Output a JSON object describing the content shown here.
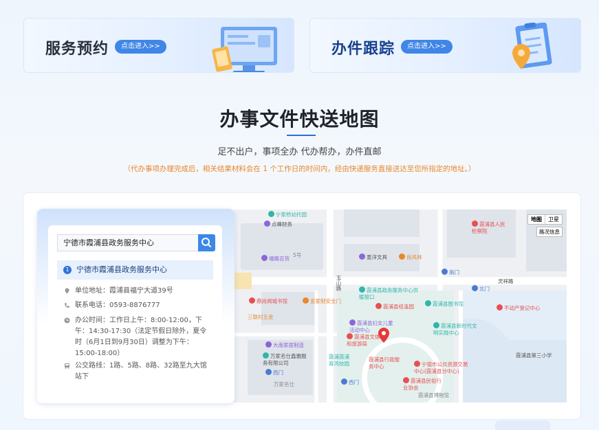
{
  "cards": {
    "appointment": {
      "title": "服务预约",
      "button": "点击进入>>"
    },
    "tracking": {
      "title": "办件跟踪",
      "button": "点击进入>>"
    }
  },
  "section": {
    "title": "办事文件快送地图",
    "subtitle": "足不出户，事项全办 代办帮办，办件直邮",
    "notice": "（代办事项办理完成后，相关结果材料会在 1 个工作日的时间内，经由快递服务直接送达至您所指定的地址。）"
  },
  "search": {
    "value": "宁德市霞浦县政务服务中心"
  },
  "result": {
    "index": "1",
    "name": "宁德市霞浦县政务服务中心",
    "address": "单位地址：霞浦县福宁大道39号",
    "phone": "联系电话：0593-8876777",
    "hours": "办公时间：工作日上午：8:00-12:00，下午：14:30-17:30（法定节假日除外，夏令时（6月1日到9月30日）调整为下午：15:00-18:00）",
    "bus": "公交路线：1路、5路、8路、32路至九大馆站下"
  },
  "map": {
    "controls": {
      "map": "地图",
      "satellite": "卫星",
      "traffic": "路况信息"
    },
    "roads": {
      "lingxiang": "灵祥路",
      "yushan": "玉山路"
    },
    "pois": [
      {
        "id": "p1",
        "label": "宁家桥幼托园",
        "color": "#2fb6a8"
      },
      {
        "id": "p2",
        "label": "点峰财务",
        "color": "#8a67d6"
      },
      {
        "id": "p3",
        "label": "福路百货",
        "color": "#8a67d6"
      },
      {
        "id": "p4",
        "label": "5号",
        "color": "#888888"
      },
      {
        "id": "p5",
        "label": "墨洋文具",
        "color": "#8a67d6"
      },
      {
        "id": "p6",
        "label": "良风林",
        "color": "#e8872b"
      },
      {
        "id": "p7",
        "label": "霞浦县人民检察院",
        "color": "#e85050"
      },
      {
        "id": "p8",
        "label": "南门",
        "color": "#4a7bd0"
      },
      {
        "id": "p9",
        "label": "北门",
        "color": "#4a7bd0"
      },
      {
        "id": "p10",
        "label": "不动产登记中心",
        "color": "#e85050"
      },
      {
        "id": "p11",
        "label": "霞浦县政务服务中心供暖窗口",
        "color": "#2fb6a8"
      },
      {
        "id": "p12",
        "label": "霞浦县桂溪园",
        "color": "#e85050"
      },
      {
        "id": "p13",
        "label": "霞浦县图书馆",
        "color": "#2fb6a8"
      },
      {
        "id": "p14",
        "label": "霞浦县妇女儿童活动中心",
        "color": "#8a67d6"
      },
      {
        "id": "p15",
        "label": "霞浦县新时代文明实践中心",
        "color": "#2fb6a8"
      },
      {
        "id": "p16",
        "label": "霞浦县文体和旅游局",
        "color": "#e85050"
      },
      {
        "id": "p17",
        "label": "霞浦县行政服务中心",
        "color": "#e85050"
      },
      {
        "id": "p18",
        "label": "宁德市公共资源交易中心(霞浦县分中心)",
        "color": "#e85050"
      },
      {
        "id": "p19",
        "label": "霞浦县民俗行业协会",
        "color": "#e85050"
      },
      {
        "id": "p20",
        "label": "霞浦县博物馆",
        "color": "#888888"
      },
      {
        "id": "p21",
        "label": "霞浦县第三小学",
        "color": "#888888"
      },
      {
        "id": "p22",
        "label": "鼎尚阅城书馆",
        "color": "#e85050"
      },
      {
        "id": "p23",
        "label": "宜家制安全门",
        "color": "#e8872b"
      },
      {
        "id": "p24",
        "label": "三联村五金",
        "color": "#e8872b"
      },
      {
        "id": "p25",
        "label": "大南家居制造",
        "color": "#8a67d6"
      },
      {
        "id": "p26",
        "label": "万家名仕鑫雅服务有限公司",
        "color": "#2fb6a8"
      },
      {
        "id": "p27",
        "label": "霞浦霞浦育鸿校园",
        "color": "#2fb6a8"
      },
      {
        "id": "p28",
        "label": "西门",
        "color": "#4a7bd0"
      },
      {
        "id": "p29",
        "label": "万家名仕",
        "color": "#888888"
      },
      {
        "id": "p30",
        "label": "西门",
        "color": "#4a7bd0"
      }
    ]
  }
}
